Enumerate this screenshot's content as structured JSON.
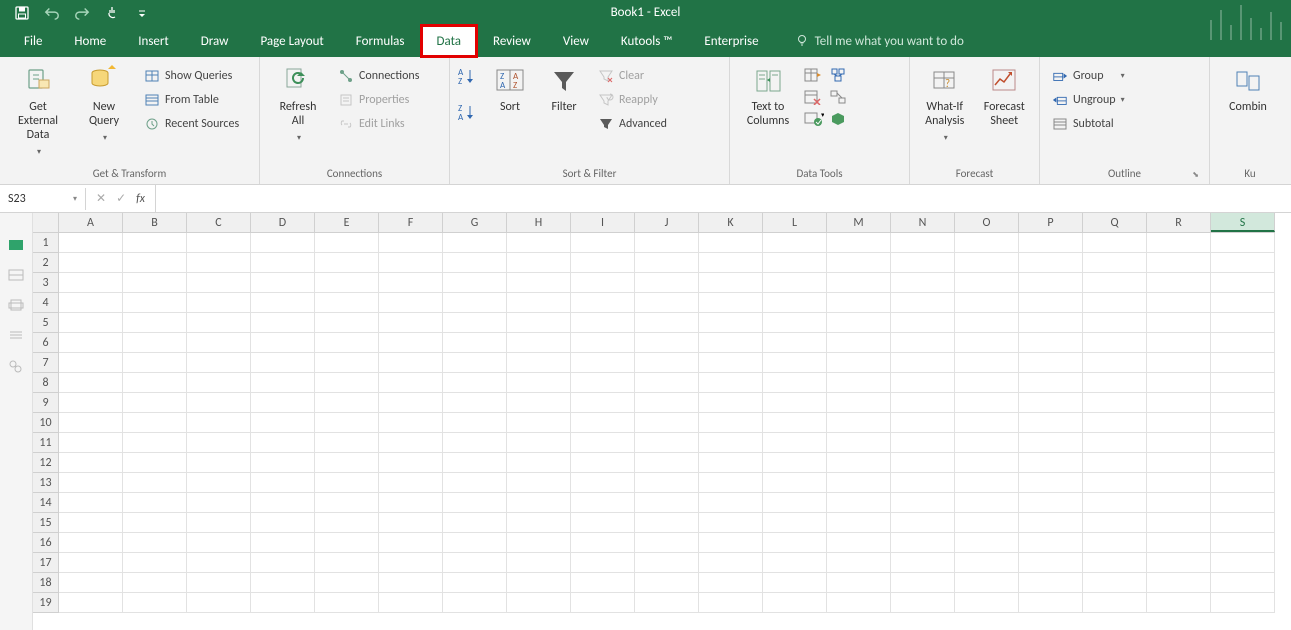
{
  "title": "Book1 - Excel",
  "quick_access": [
    "save",
    "undo",
    "redo",
    "touch",
    "customize"
  ],
  "ribbon_tabs": [
    {
      "label": "File"
    },
    {
      "label": "Home"
    },
    {
      "label": "Insert"
    },
    {
      "label": "Draw"
    },
    {
      "label": "Page Layout"
    },
    {
      "label": "Formulas"
    },
    {
      "label": "Data"
    },
    {
      "label": "Review"
    },
    {
      "label": "View"
    },
    {
      "label": "Kutools ™"
    },
    {
      "label": "Enterprise"
    }
  ],
  "active_tab": "Data",
  "highlighted_tab": "Data",
  "tellme": "Tell me what you want to do",
  "groups": {
    "get_transform": {
      "label": "Get & Transform",
      "get_external": "Get External\nData",
      "new_query": "New\nQuery",
      "show_queries": "Show Queries",
      "from_table": "From Table",
      "recent_sources": "Recent Sources"
    },
    "connections": {
      "label": "Connections",
      "refresh_all": "Refresh\nAll",
      "connections": "Connections",
      "properties": "Properties",
      "edit_links": "Edit Links"
    },
    "sort_filter": {
      "label": "Sort & Filter",
      "sort": "Sort",
      "filter": "Filter",
      "clear": "Clear",
      "reapply": "Reapply",
      "advanced": "Advanced"
    },
    "data_tools": {
      "label": "Data Tools",
      "text_to_columns": "Text to\nColumns"
    },
    "forecast": {
      "label": "Forecast",
      "what_if": "What-If\nAnalysis",
      "forecast_sheet": "Forecast\nSheet"
    },
    "outline": {
      "label": "Outline",
      "group": "Group",
      "ungroup": "Ungroup",
      "subtotal": "Subtotal"
    },
    "kutools_group": {
      "label": "Ku",
      "combine": "Combin"
    }
  },
  "name_box": "S23",
  "formula": "",
  "columns": [
    "A",
    "B",
    "C",
    "D",
    "E",
    "F",
    "G",
    "H",
    "I",
    "J",
    "K",
    "L",
    "M",
    "N",
    "O",
    "P",
    "Q",
    "R",
    "S"
  ],
  "selected_column": "S",
  "rows": [
    1,
    2,
    3,
    4,
    5,
    6,
    7,
    8,
    9,
    10,
    11,
    12,
    13,
    14,
    15,
    16,
    17,
    18,
    19
  ]
}
